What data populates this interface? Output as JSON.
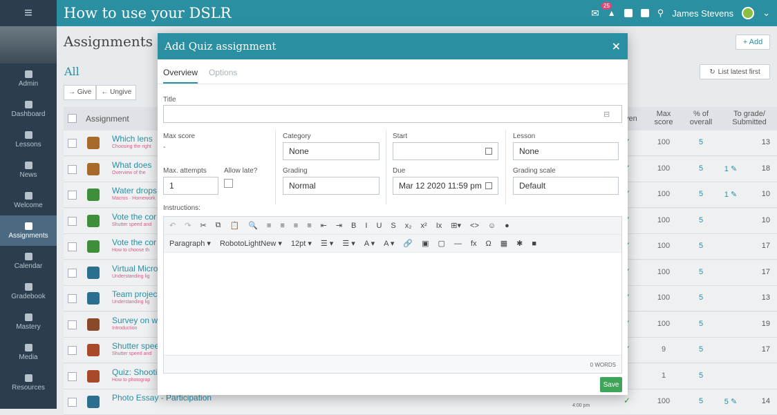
{
  "topbar": {
    "menu_icon": "hamburger-icon",
    "course_title": "How to use your DSLR",
    "badge_count": "25",
    "user_name": "James Stevens"
  },
  "sidebar": {
    "items": [
      {
        "label": "Admin",
        "icon": "gear-icon"
      },
      {
        "label": "Dashboard",
        "icon": "dashboard-icon"
      },
      {
        "label": "Lessons",
        "icon": "lessons-icon"
      },
      {
        "label": "News",
        "icon": "news-icon"
      },
      {
        "label": "Welcome",
        "icon": "welcome-icon"
      },
      {
        "label": "Assignments",
        "icon": "assignments-icon"
      },
      {
        "label": "Calendar",
        "icon": "calendar-icon"
      },
      {
        "label": "Gradebook",
        "icon": "gradebook-icon"
      },
      {
        "label": "Mastery",
        "icon": "mastery-icon"
      },
      {
        "label": "Media",
        "icon": "media-icon"
      },
      {
        "label": "Resources",
        "icon": "resources-icon"
      }
    ]
  },
  "main": {
    "title": "Assignments",
    "add_label": "+ Add",
    "filter": "All",
    "sort_label": "List latest first",
    "give_label": "→ Give",
    "ungive_label": "← Ungive",
    "col_assignment": "Assignment",
    "col_given": "ven",
    "col_max": "Max score",
    "col_pct": "% of overall",
    "col_grade": "To grade/ Submitted"
  },
  "rows": [
    {
      "title": "Which lens",
      "sub": "Choosing the right",
      "max": "100",
      "pct": "5",
      "grade": "",
      "sub_count": "13",
      "color": "#a86a2a"
    },
    {
      "title": "What does",
      "sub": "Overview of the",
      "max": "100",
      "pct": "5",
      "grade": "1 ✎",
      "sub_count": "18",
      "color": "#a86a2a"
    },
    {
      "title": "Water drops",
      "sub": "Macros · Homework",
      "max": "100",
      "pct": "5",
      "grade": "1 ✎",
      "sub_count": "10",
      "color": "#3f8f3a"
    },
    {
      "title": "Vote the cor",
      "sub": "Shutter speed and",
      "max": "100",
      "pct": "5",
      "grade": "",
      "sub_count": "10",
      "color": "#3f8f3a"
    },
    {
      "title": "Vote the cor",
      "sub": "How to choose th",
      "max": "100",
      "pct": "5",
      "grade": "",
      "sub_count": "17",
      "color": "#3f8f3a"
    },
    {
      "title": "Virtual Micro",
      "sub": "Understanding lig",
      "max": "100",
      "pct": "5",
      "grade": "",
      "sub_count": "17",
      "color": "#2b6f8f"
    },
    {
      "title": "Team projec",
      "sub": "Understanding lig",
      "max": "100",
      "pct": "5",
      "grade": "",
      "sub_count": "13",
      "color": "#2b6f8f"
    },
    {
      "title": "Survey on w",
      "sub": "Introduction",
      "max": "100",
      "pct": "5",
      "grade": "",
      "sub_count": "19",
      "color": "#8a4a2a"
    },
    {
      "title": "Shutter spee",
      "sub": "Shutter speed and",
      "max": "9",
      "pct": "5",
      "grade": "",
      "sub_count": "17",
      "color": "#a84a2a"
    },
    {
      "title": "Quiz: Shooti",
      "sub": "How to photograp",
      "max": "1",
      "pct": "5",
      "grade": "",
      "sub_count": "",
      "color": "#a84a2a"
    },
    {
      "title": "Photo Essay - Participation",
      "sub": "",
      "max": "100",
      "pct": "5",
      "grade": "5 ✎",
      "sub_count": "14",
      "color": "#2b6f8f",
      "time": "4:00 pm"
    }
  ],
  "modal": {
    "title": "Add Quiz assignment",
    "close": "×",
    "tab_overview": "Overview",
    "tab_options": "Options",
    "title_label": "Title",
    "title_value": "",
    "max_score_label": "Max score",
    "max_score_value": "-",
    "category_label": "Category",
    "category_value": "None",
    "start_label": "Start",
    "start_value": "",
    "lesson_label": "Lesson",
    "lesson_value": "None",
    "attempts_label": "Max. attempts",
    "attempts_value": "1",
    "late_label": "Allow late?",
    "grading_label": "Grading",
    "grading_value": "Normal",
    "due_label": "Due",
    "due_value": "Mar 12 2020 11:59 pm",
    "scale_label": "Grading scale",
    "scale_value": "Default",
    "instructions_label": "Instructions:",
    "toolbar1": [
      "↶",
      "↷",
      "✂",
      "⧉",
      "📋",
      "🔍",
      "≡",
      "≡",
      "≡",
      "≡",
      "⇤",
      "⇥",
      "B",
      "I",
      "U",
      "S",
      "x₂",
      "x²",
      "Ix",
      "⊞▾",
      "<>",
      "☺",
      "●"
    ],
    "toolbar2": [
      "Paragraph ▾",
      "RobotoLightNew ▾",
      "12pt ▾",
      "☰ ▾",
      "☰ ▾",
      "A ▾",
      "A ▾",
      "🔗",
      "▣",
      "▢",
      "—",
      "fx",
      "Ω",
      "▦",
      "✱",
      "■"
    ],
    "word_count": "0 WORDS",
    "save_label": "Save"
  }
}
